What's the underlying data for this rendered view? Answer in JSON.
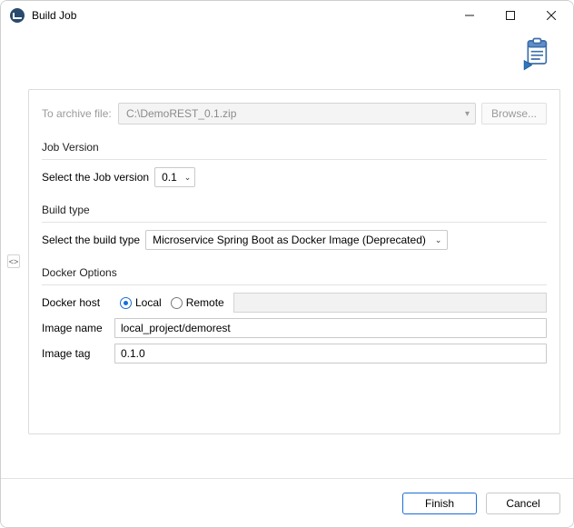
{
  "window": {
    "title": "Build Job"
  },
  "archive": {
    "label": "To archive file:",
    "value": "C:\\DemoREST_0.1.zip",
    "browse": "Browse..."
  },
  "jobVersion": {
    "section": "Job Version",
    "label": "Select the Job version",
    "value": "0.1"
  },
  "buildType": {
    "section": "Build type",
    "label": "Select the build type",
    "value": "Microservice Spring Boot as Docker Image (Deprecated)"
  },
  "docker": {
    "section": "Docker Options",
    "hostLabel": "Docker host",
    "options": {
      "local": "Local",
      "remote": "Remote"
    },
    "imageNameLabel": "Image name",
    "imageName": "local_project/demorest",
    "imageTagLabel": "Image tag",
    "imageTag": "0.1.0"
  },
  "toggleHandle": "<>",
  "footer": {
    "finish": "Finish",
    "cancel": "Cancel"
  }
}
